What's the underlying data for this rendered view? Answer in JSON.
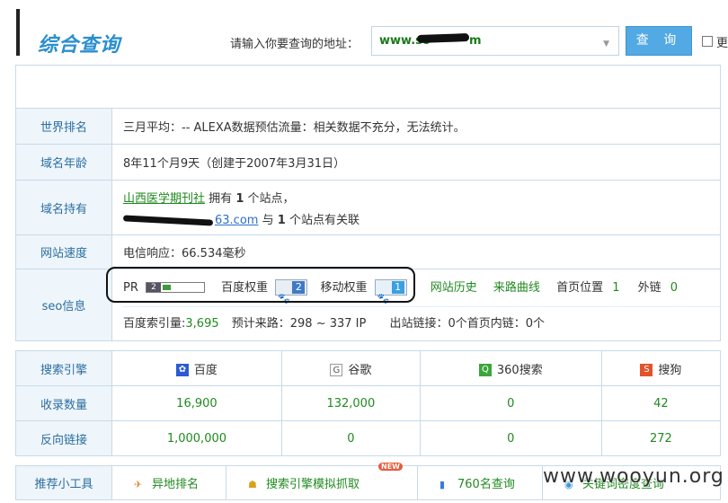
{
  "header": {
    "title": "综合查询",
    "prompt": "请输入你要查询的地址：",
    "input_value": "www.so",
    "input_value_tail": "m",
    "search_label": "查 询",
    "more_label": "更"
  },
  "info": {
    "world_rank": {
      "label": "世界排名",
      "text": "三月平均：-- ALEXA数据预估流量：相关数据不充分，无法统计。"
    },
    "domain_age": {
      "label": "域名年龄",
      "text": "8年11个月9天（创建于2007年3月31日）"
    },
    "domain_owner": {
      "label": "域名持有",
      "owner_name": "山西医学期刊社",
      "owns_prefix": "拥有",
      "owns_count": "1",
      "owns_suffix": "个站点，",
      "email_tail": "63.com",
      "related_prefix": "与",
      "related_count": "1",
      "related_suffix": "个站点有关联"
    },
    "speed": {
      "label": "网站速度",
      "text": "电信响应：66.534毫秒"
    },
    "seo": {
      "label": "seo信息",
      "pr_label": "PR",
      "pr_value": "2",
      "pr_fill": 0.2,
      "baidu_weight_label": "百度权重",
      "baidu_weight": "2",
      "mobile_weight_label": "移动权重",
      "mobile_weight": "1",
      "history_link": "网站历史",
      "traffic_link": "来路曲线",
      "homepage_label": "首页位置",
      "homepage_value": "1",
      "external_label": "外链",
      "external_value": "0",
      "baidu_index_label": "百度索引量:",
      "baidu_index_value": "3,695",
      "estimated_label": "预计来路：298 ~ 337 IP",
      "links_text": "出站链接：0个首页内链：0个"
    }
  },
  "engines": {
    "label": "搜索引擎",
    "headers": [
      {
        "name": "百度",
        "icon": "baidu-icon",
        "color": "#2c5bd1"
      },
      {
        "name": "谷歌",
        "icon": "google-icon",
        "color": "#555555"
      },
      {
        "name": "360搜索",
        "icon": "so360-icon",
        "color": "#3aa63a"
      },
      {
        "name": "搜狗",
        "icon": "sogou-icon",
        "color": "#e2532a"
      }
    ],
    "rows": [
      {
        "label": "收录数量",
        "values": [
          "16,900",
          "132,000",
          "0",
          "42"
        ]
      },
      {
        "label": "反向链接",
        "values": [
          "1,000,000",
          "0",
          "0",
          "272"
        ]
      }
    ]
  },
  "tools": {
    "label": "推荐小工具",
    "items": [
      "异地排名",
      "搜索引擎模拟抓取",
      "760名查询",
      "关键词密度查询"
    ],
    "new_badge": "NEW"
  },
  "watermark": "www.wooyun.org"
}
